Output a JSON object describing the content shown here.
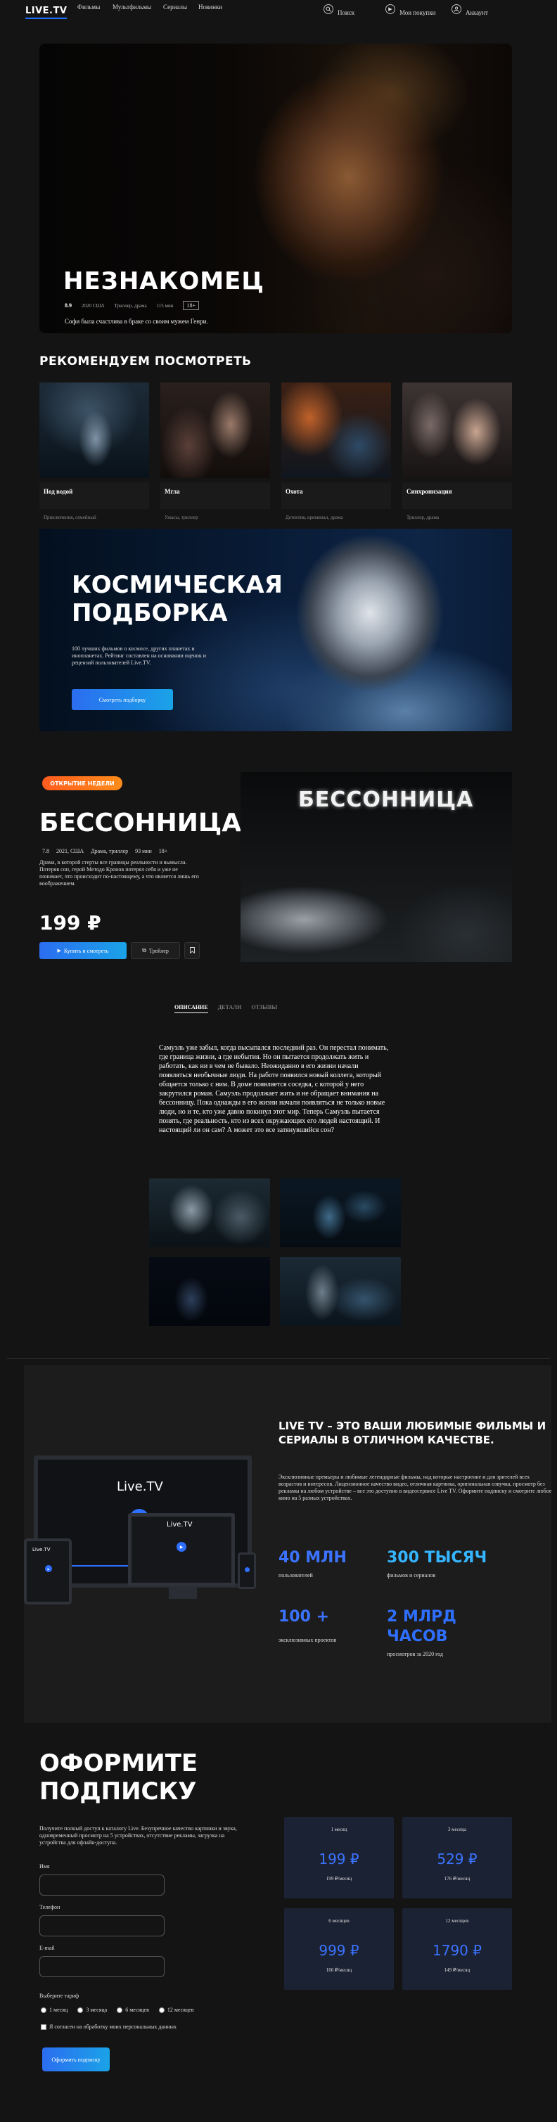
{
  "header": {
    "logo": "LIVE.TV",
    "nav": [
      "Фильмы",
      "Мультфильмы",
      "Сериалы",
      "Новинки"
    ],
    "search_label": "Поиск",
    "purchases_label": "Мои покупки",
    "account_label": "Аккаунт"
  },
  "hero": {
    "title": "НЕЗНАКОМЕЦ",
    "rating": "8.9",
    "meta": [
      "2020 США",
      "Триллер, драма",
      "115 мин"
    ],
    "age": "18+",
    "description": "Софи была счастлива в браке со своим мужем Генри."
  },
  "recommended": {
    "title": "РЕКОМЕНДУЕМ ПОСМОТРЕТЬ",
    "items": [
      {
        "title": "Под водой",
        "genres": "Приключения, семейный"
      },
      {
        "title": "Мгла",
        "genres": "Ужасы, триллер"
      },
      {
        "title": "Охота",
        "genres": "Детектив, криминал, драма"
      },
      {
        "title": "Синхронизация",
        "genres": "Триллер, драма"
      }
    ]
  },
  "cosmic": {
    "title_line1": "КОСМИЧЕСКАЯ",
    "title_line2": "ПОДБОРКА",
    "text": "100 лучших фильмов о космосе, других планетах и инопланетах. Рейтинг составлен на основании оценок и рецензий пользователей Live.TV.",
    "button": "Смотреть подборку"
  },
  "premiere": {
    "badge": "ОТКРЫТИЕ НЕДЕЛИ",
    "title": "БЕССОННИЦА",
    "rating": "7.8",
    "year_country": "2021, США",
    "genres": "Драма, триллер",
    "duration": "93 мин",
    "age": "18+",
    "description": "Драма, в которой стерты все границы реальности и вымысла. Потеряв сон, герой Методо Кронов потерял себя и уже не понимает, что происходит по-настоящему, а что является лишь его воображением.",
    "price": "199 ₽",
    "buy_button": "Купить и смотреть",
    "trailer_button": "Трейлер",
    "poster_title": "БЕССОННИЦА"
  },
  "tabs": [
    "ОПИСАНИЕ",
    "ДЕТАЛИ",
    "ОТЗЫВЫ"
  ],
  "synopsis": "Самуэль уже забыл, когда высыпался последний раз. Он перестал понимать, где граница жизни, а где небытия. Но он пытается продолжать жить и работать, как ни в чем не бывало. Неожиданно в его жизни начали появляться необычные люди. На работе появился новый коллега, который общается только с ним. В доме появляется соседка, с которой у него закрутился роман. Самуэль продолжает жить и не обращает внимания на бессонницу. Пока однажды в его жизни начали появляться не только новые люди, но и те, кто уже давно покинул этот мир. Теперь Самуэль пытается понять, где реальность, кто из всех окружающих его людей настоящий. И настоящий ли он сам? А может это все затянувшийся сон?",
  "about": {
    "title": "LIVE TV – ЭТО ВАШИ ЛЮБИМЫЕ ФИЛЬМЫ И СЕРИАЛЫ В ОТЛИЧНОМ КАЧЕСТВЕ.",
    "text": "Эксклюзивные премьеры и любимые легендарные фильмы, над которые настроение и для зрителей всех возрастов и интересов. Лицензионное качество видео, отличная картинка, оригинальная озвучка, просмотр без рекламы на любом устройстве – все это доступно в видеосервисе Live TV. Оформите подписку и смотрите любое кино на 5 разных устройствах.",
    "device_logo": "Live.TV",
    "stats": [
      {
        "value": "40 МЛН",
        "label": "пользователей"
      },
      {
        "value": "300 ТЫСЯЧ",
        "label": "фильмов и сериалов"
      },
      {
        "value": "100 +",
        "label": "эксклюзивных проектов"
      },
      {
        "value": "2 МЛРД ЧАСОВ",
        "label": "просмотров за 2020 год"
      }
    ]
  },
  "subscription": {
    "title_line1": "ОФОРМИТЕ",
    "title_line2": "ПОДПИСКУ",
    "description": "Получите полный доступ к каталогу Live. Безупречное качество картинки и звука, одновременный просмотр на 5 устройствах, отсутствие рекламы, загрузка на устройства для офлайн-доступа.",
    "name_label": "Имя",
    "phone_label": "Телефон",
    "email_label": "E-mail",
    "tariff_label": "Выберите тариф",
    "tariff_options": [
      "1 месяц",
      "3 месяца",
      "6 месяцев",
      "12 месяцев"
    ],
    "consent": "Я согласен на обработку моих персональных данных",
    "submit": "Оформить подписку",
    "plans": [
      {
        "period": "1 месяц",
        "price": "199 ₽",
        "monthly": "199 ₽/месяц"
      },
      {
        "period": "3 месяца",
        "price": "529 ₽",
        "monthly": "176 ₽/месяц"
      },
      {
        "period": "6 месяцев",
        "price": "999 ₽",
        "monthly": "166 ₽/месяц"
      },
      {
        "period": "12 месяцев",
        "price": "1790 ₽",
        "monthly": "149 ₽/месяц"
      }
    ]
  }
}
